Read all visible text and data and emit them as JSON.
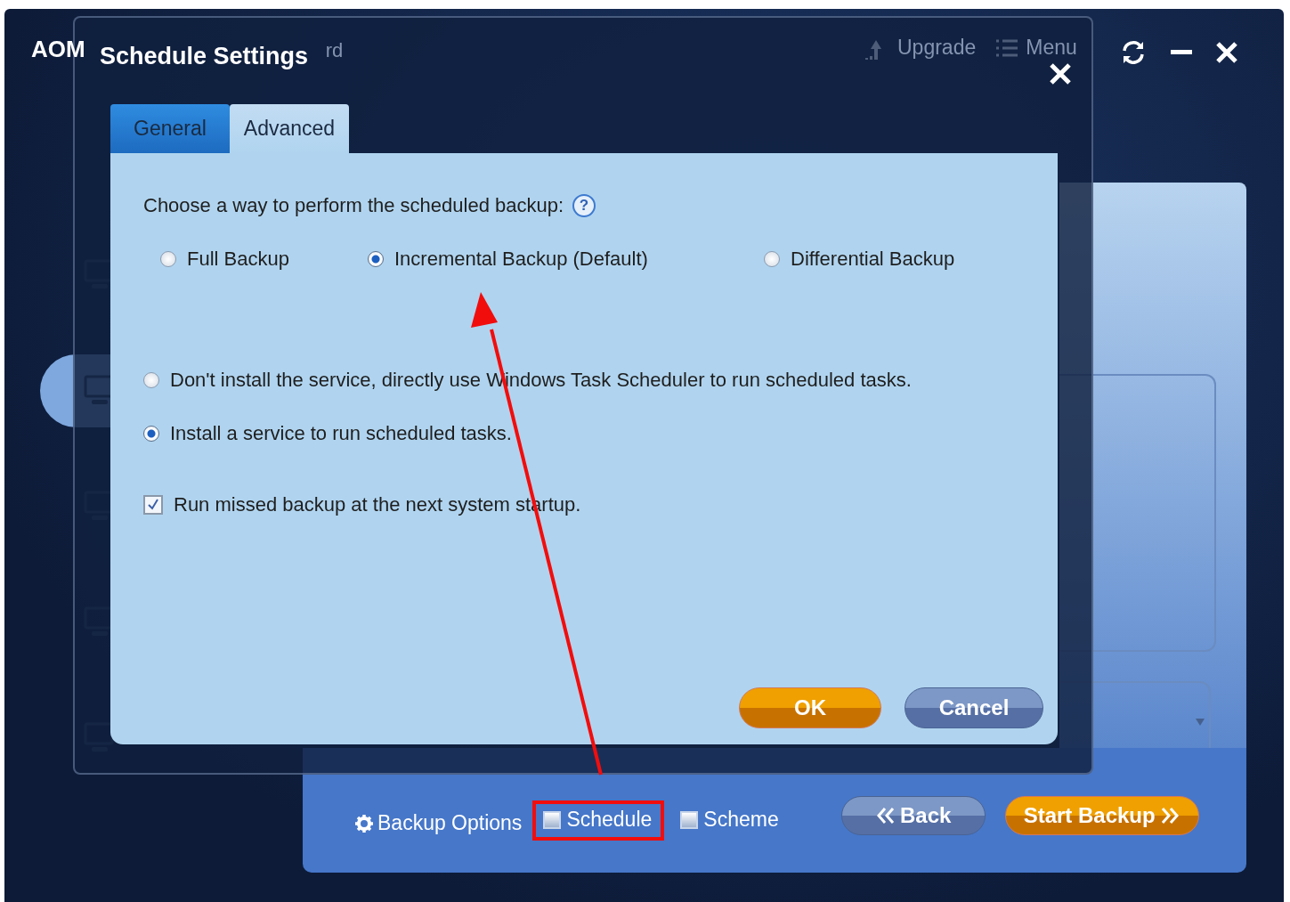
{
  "app": {
    "title_fragments": [
      "AOM",
      "rd"
    ],
    "toolbar": [
      {
        "kind": "upgrade",
        "label": "Upgrade"
      },
      {
        "kind": "menu",
        "label": "Menu"
      }
    ]
  },
  "dialog": {
    "title": "Schedule Settings",
    "tabs": [
      {
        "label": "General",
        "selected": false
      },
      {
        "label": "Advanced",
        "selected": true
      }
    ],
    "prompt": "Choose a way to perform the scheduled backup:",
    "help": "?",
    "backup_types": [
      {
        "label": "Full Backup",
        "selected": false
      },
      {
        "label": "Incremental Backup (Default)",
        "selected": true
      },
      {
        "label": "Differential Backup",
        "selected": false
      }
    ],
    "service_options": [
      {
        "label": "Don't install the service, directly use Windows Task Scheduler to run scheduled tasks.",
        "selected": false
      },
      {
        "label": "Install a service to run scheduled tasks.",
        "selected": true
      }
    ],
    "run_missed": {
      "label": "Run missed backup at the next system startup.",
      "checked": true
    },
    "buttons": [
      {
        "kind": "primary",
        "label": "OK"
      },
      {
        "kind": "secondary",
        "label": "Cancel"
      }
    ]
  },
  "bottom_bar": {
    "backup_options": "Backup Options",
    "options": [
      {
        "label": "Schedule",
        "checked": false,
        "highlighted": true
      },
      {
        "label": "Scheme",
        "checked": false,
        "highlighted": false
      }
    ],
    "buttons": [
      {
        "kind": "back",
        "label": "Back"
      },
      {
        "kind": "start",
        "label": "Start Backup"
      }
    ]
  }
}
